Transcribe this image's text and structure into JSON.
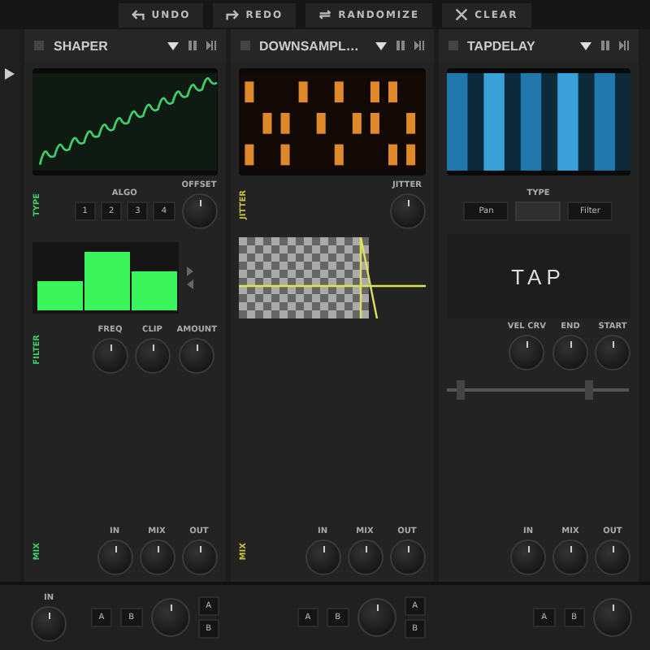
{
  "toolbar": [
    {
      "kind": "undo",
      "label": "UNDO"
    },
    {
      "kind": "redo",
      "label": "REDO"
    },
    {
      "kind": "randomize",
      "label": "RANDOMIZE"
    },
    {
      "kind": "clear",
      "label": "CLEAR"
    }
  ],
  "modules": [
    {
      "kind": "shaper",
      "title": "SHAPER",
      "side_label": "TYPE",
      "algo_label": "ALGO",
      "algo_buttons": [
        "1",
        "2",
        "3",
        "4"
      ],
      "offset_label": "OFFSET",
      "filter_label": "FILTER",
      "filter_knobs": [
        "FREQ",
        "CLIP",
        "AMOUNT"
      ],
      "mix_label": "MIX",
      "mix_knobs": [
        "IN",
        "MIX",
        "OUT"
      ]
    },
    {
      "kind": "downsampler",
      "title": "DOWNSAMPL…",
      "side_label": "JITTER",
      "jitter_label": "JITTER",
      "mix_label": "MIX",
      "mix_knobs": [
        "IN",
        "MIX",
        "OUT"
      ]
    },
    {
      "kind": "tapdelay",
      "title": "TAPDELAY",
      "type_label": "TYPE",
      "type_buttons": [
        {
          "label": "Pan",
          "disabled": false
        },
        {
          "disabled": true
        },
        {
          "label": "Filter",
          "disabled": false
        }
      ],
      "tap": "TAP",
      "slider_thumbs": [
        {
          "level": 0.08
        },
        {
          "level": 0.78
        }
      ],
      "knobs": [
        "VEL CRV",
        "END",
        "START"
      ],
      "mix_knobs": [
        "IN",
        "MIX",
        "OUT"
      ]
    }
  ],
  "bottom": {
    "in_label": "IN",
    "slots": [
      {
        "a": "A",
        "b": "B",
        "side_a": "A",
        "side_b": "B"
      },
      {
        "a": "A",
        "b": "B",
        "side_a": "A",
        "side_b": "B"
      },
      {
        "a": "A",
        "b": "B"
      }
    ]
  }
}
